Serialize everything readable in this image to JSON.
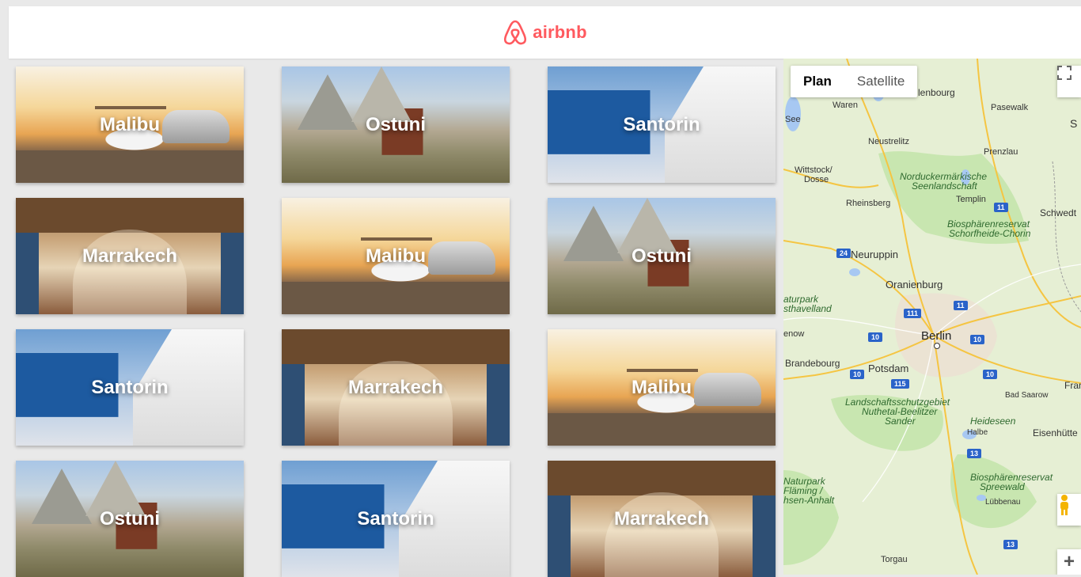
{
  "header": {
    "brand": "airbnb",
    "brand_color": "#FF5A5F"
  },
  "cards": [
    {
      "title": "Malibu"
    },
    {
      "title": "Ostuni"
    },
    {
      "title": "Santorin"
    },
    {
      "title": "Marrakech"
    },
    {
      "title": "Malibu"
    },
    {
      "title": "Ostuni"
    },
    {
      "title": "Santorin"
    },
    {
      "title": "Marrakech"
    },
    {
      "title": "Malibu"
    },
    {
      "title": "Ostuni"
    },
    {
      "title": "Santorin"
    },
    {
      "title": "Marrakech"
    }
  ],
  "map": {
    "type_buttons": {
      "plan": "Plan",
      "satellite": "Satellite"
    },
    "zoom_in": "+",
    "labels": {
      "waren": "Waren",
      "see": "See",
      "lenbourg": "lenbourg",
      "pasewalk": "Pasewalk",
      "s": "S",
      "neustrelitz": "Neustrelitz",
      "prenzlau": "Prenzlau",
      "wittstock": "Wittstock/",
      "dosse": "Dosse",
      "norduckermarkische": "Norduckermärkische",
      "seenlandschaft": "Seenlandschaft",
      "templin": "Templin",
      "rheinsberg": "Rheinsberg",
      "schwedt": "Schwedt",
      "biosphare1": "Biosphärenreservat",
      "schorfheide": "Schorfheide-Chorin",
      "neuruppin": "Neuruppin",
      "oranienburg": "Oranienburg",
      "naturpark1": "aturpark",
      "havelland": "sthavelland",
      "nenow": "enow",
      "berlin": "Berlin",
      "brandebourg": "Brandebourg",
      "potsdam": "Potsdam",
      "franc": "Franc",
      "bad_saarow": "Bad Saarow",
      "landschaft": "Landschaftsschutzgebiet",
      "nuthetal": "Nuthetal-Beelitzer",
      "sander": "Sander",
      "heideseen": "Heideseen",
      "halbe": "Halbe",
      "eisenhutte": "Eisenhütte",
      "naturpark2": "Naturpark",
      "flaming": "Fläming /",
      "anhalt": "hsen-Anhalt",
      "biosphare2": "Biosphärenreservat",
      "spreewald": "Spreewald",
      "lubbenau": "Lübbenau",
      "torgau": "Torgau"
    },
    "shields": {
      "s24": "24",
      "s11a": "11",
      "s11b": "11",
      "s111": "111",
      "s10a": "10",
      "s10b": "10",
      "s10c": "10",
      "s10d": "10",
      "s115": "115",
      "s13a": "13",
      "s13b": "13"
    }
  }
}
